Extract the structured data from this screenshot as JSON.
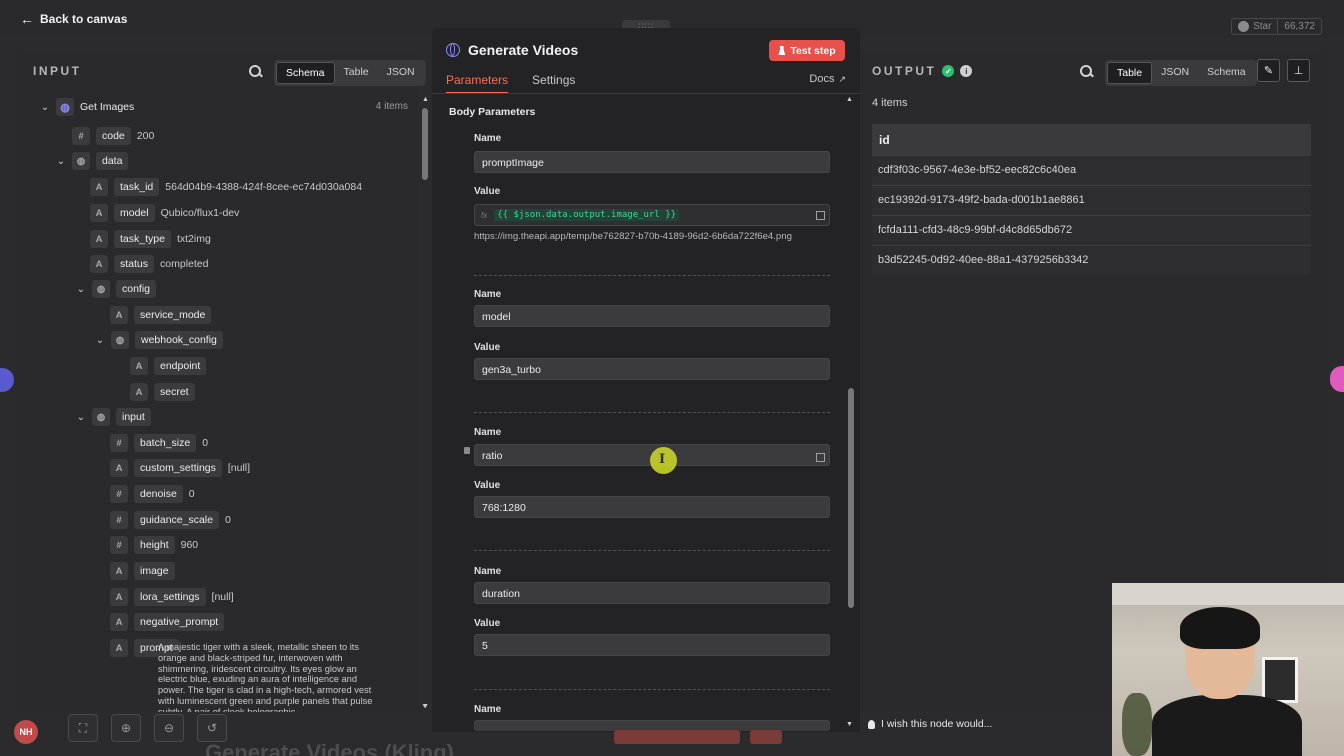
{
  "topbar": {
    "back_label": "Back to canvas",
    "github_star": "Star",
    "github_count": "66,372"
  },
  "input": {
    "header": "INPUT",
    "view_tabs": [
      "Schema",
      "Table",
      "JSON"
    ],
    "node_name": "Get Images",
    "items_count": "4 items",
    "fields": {
      "code": {
        "key": "code",
        "value": "200",
        "type": "#"
      },
      "data": {
        "key": "data"
      },
      "task_id": {
        "key": "task_id",
        "value": "564d04b9-4388-424f-8cee-ec74d030a084",
        "type": "A"
      },
      "model": {
        "key": "model",
        "value": "Qubico/flux1-dev",
        "type": "A"
      },
      "task_type": {
        "key": "task_type",
        "value": "txt2img",
        "type": "A"
      },
      "status": {
        "key": "status",
        "value": "completed",
        "type": "A"
      },
      "config": {
        "key": "config"
      },
      "service_mode": {
        "key": "service_mode",
        "type": "A"
      },
      "webhook_config": {
        "key": "webhook_config"
      },
      "endpoint": {
        "key": "endpoint",
        "type": "A"
      },
      "secret": {
        "key": "secret",
        "type": "A"
      },
      "input": {
        "key": "input"
      },
      "batch_size": {
        "key": "batch_size",
        "value": "0",
        "type": "#"
      },
      "custom_settings": {
        "key": "custom_settings",
        "value": "[null]",
        "type": "A"
      },
      "denoise": {
        "key": "denoise",
        "value": "0",
        "type": "#"
      },
      "guidance_scale": {
        "key": "guidance_scale",
        "value": "0",
        "type": "#"
      },
      "height": {
        "key": "height",
        "value": "960",
        "type": "#"
      },
      "image": {
        "key": "image",
        "type": "A"
      },
      "lora_settings": {
        "key": "lora_settings",
        "value": "[null]",
        "type": "A"
      },
      "negative_prompt": {
        "key": "negative_prompt",
        "type": "A"
      },
      "prompt": {
        "key": "prompt",
        "type": "A",
        "value": "A majestic tiger with a sleek, metallic sheen to its orange and black-striped fur, interwoven with shimmering, iridescent circuitry. Its eyes glow an electric blue, exuding an aura of intelligence and power. The tiger is clad in a high-tech, armored vest with luminescent green and purple panels that pulse subtly. A pair of sleek holographic"
      }
    }
  },
  "node": {
    "title": "Generate Videos",
    "test_step_label": "Test step",
    "tabs": [
      "Parameters",
      "Settings"
    ],
    "docs_label": "Docs",
    "section_title": "Body Parameters",
    "name_label": "Name",
    "value_label": "Value",
    "params": [
      {
        "name": "promptImage",
        "value": "{{ $json.data.output.image_url }}",
        "hint": "https://img.theapi.app/temp/be762827-b70b-4189-96d2-6b6da722f6e4.png"
      },
      {
        "name": "model",
        "value": "gen3a_turbo"
      },
      {
        "name": "ratio",
        "value": "768:1280"
      },
      {
        "name": "duration",
        "value": "5"
      }
    ],
    "fx_label": "fx",
    "wish_text": "I wish this node would..."
  },
  "output": {
    "header": "OUTPUT",
    "view_tabs": [
      "Table",
      "JSON",
      "Schema"
    ],
    "items_count": "4 items",
    "column": "id",
    "rows": [
      "cdf3f03c-9567-4e3e-bf52-eec82c6c40ea",
      "ec19392d-9173-49f2-bada-d001b1ae8861",
      "fcfda111-cfd3-48c9-99bf-d4c8d65db672",
      "b3d52245-0d92-40ee-88a1-4379256b3342"
    ]
  },
  "canvas": {
    "avatar_initials": "NH",
    "background_title": "Generate Videos (Kling)"
  },
  "colors": {
    "accent": "#ff6d5a",
    "test_button": "#e8504b",
    "success": "#2fbf71",
    "expression": "#41d49a"
  }
}
